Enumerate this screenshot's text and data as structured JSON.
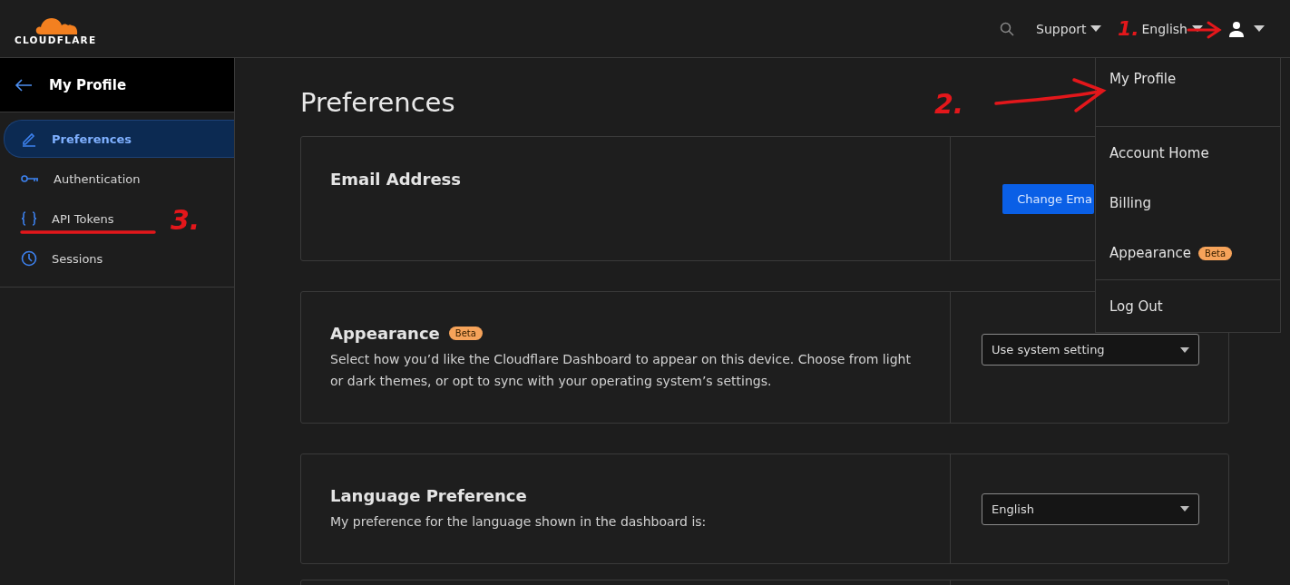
{
  "header": {
    "logo": "CLOUDFLARE",
    "nav": [
      {
        "label": "Support"
      },
      {
        "label": "English"
      }
    ]
  },
  "sidebar": {
    "title": "My Profile",
    "items": [
      {
        "label": "Preferences",
        "selected": true
      },
      {
        "label": "Authentication",
        "selected": false
      },
      {
        "label": "API Tokens",
        "selected": false
      },
      {
        "label": "Sessions",
        "selected": false
      }
    ]
  },
  "page": {
    "title": "Preferences",
    "cards": [
      {
        "kind": "button",
        "title": "Email Address",
        "button": "Change Ema"
      },
      {
        "kind": "select",
        "title": "Appearance",
        "badge": "Beta",
        "description": "Select how you’d like the Cloudflare Dashboard to appear on this device. Choose from light or dark themes, or opt to sync with your operating system’s settings.",
        "value": "Use system setting"
      },
      {
        "kind": "select",
        "title": "Language Preference",
        "description": "My preference for the language shown in the dashboard is:",
        "value": "English"
      },
      {
        "kind": "empty"
      }
    ]
  },
  "user_menu": {
    "sections": [
      {
        "items": [
          {
            "label": "My Profile"
          }
        ]
      },
      {
        "items": [
          {
            "label": "Account Home"
          },
          {
            "label": "Billing"
          },
          {
            "label": "Appearance",
            "badge": "Beta"
          }
        ]
      },
      {
        "items": [
          {
            "label": "Log Out"
          }
        ]
      }
    ]
  },
  "annotations": [
    {
      "label": "1."
    },
    {
      "label": "2."
    },
    {
      "label": "3."
    }
  ]
}
